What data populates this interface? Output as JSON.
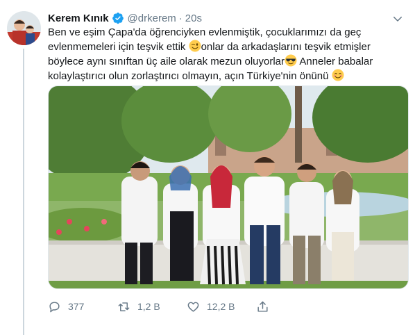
{
  "tweet": {
    "display_name": "Kerem Kınık",
    "handle": "@drkerem",
    "separator": "·",
    "time": "20s",
    "text_line1": "Ben ve eşim Çapa'da öğrenciyken evlenmiştik, çocuklarımızı da geç",
    "text_line2a": "evlenmemeleri için teşvik ettik ",
    "text_line2b": "onlar da arkadaşlarını teşvik etmişler",
    "text_line3a": "böylece aynı sınıftan üç aile olarak mezun oluyorlar",
    "text_line3b": " Anneler babalar",
    "text_line4": "kolaylaştırıcı olun zorlaştırıcı olmayın, açın Türkiye'nin önünü ",
    "emojis": [
      "winking-face-emoji",
      "sunglasses-face-emoji",
      "smiling-face-emoji"
    ],
    "media_description_icon": "photo"
  },
  "actions": {
    "reply_count": "377",
    "retweet_count": "1,2 B",
    "like_count": "12,2 B"
  },
  "colors": {
    "text": "#14171a",
    "secondary": "#657786",
    "verified": "#1da1f2",
    "thread_line": "#ccd6dd"
  }
}
